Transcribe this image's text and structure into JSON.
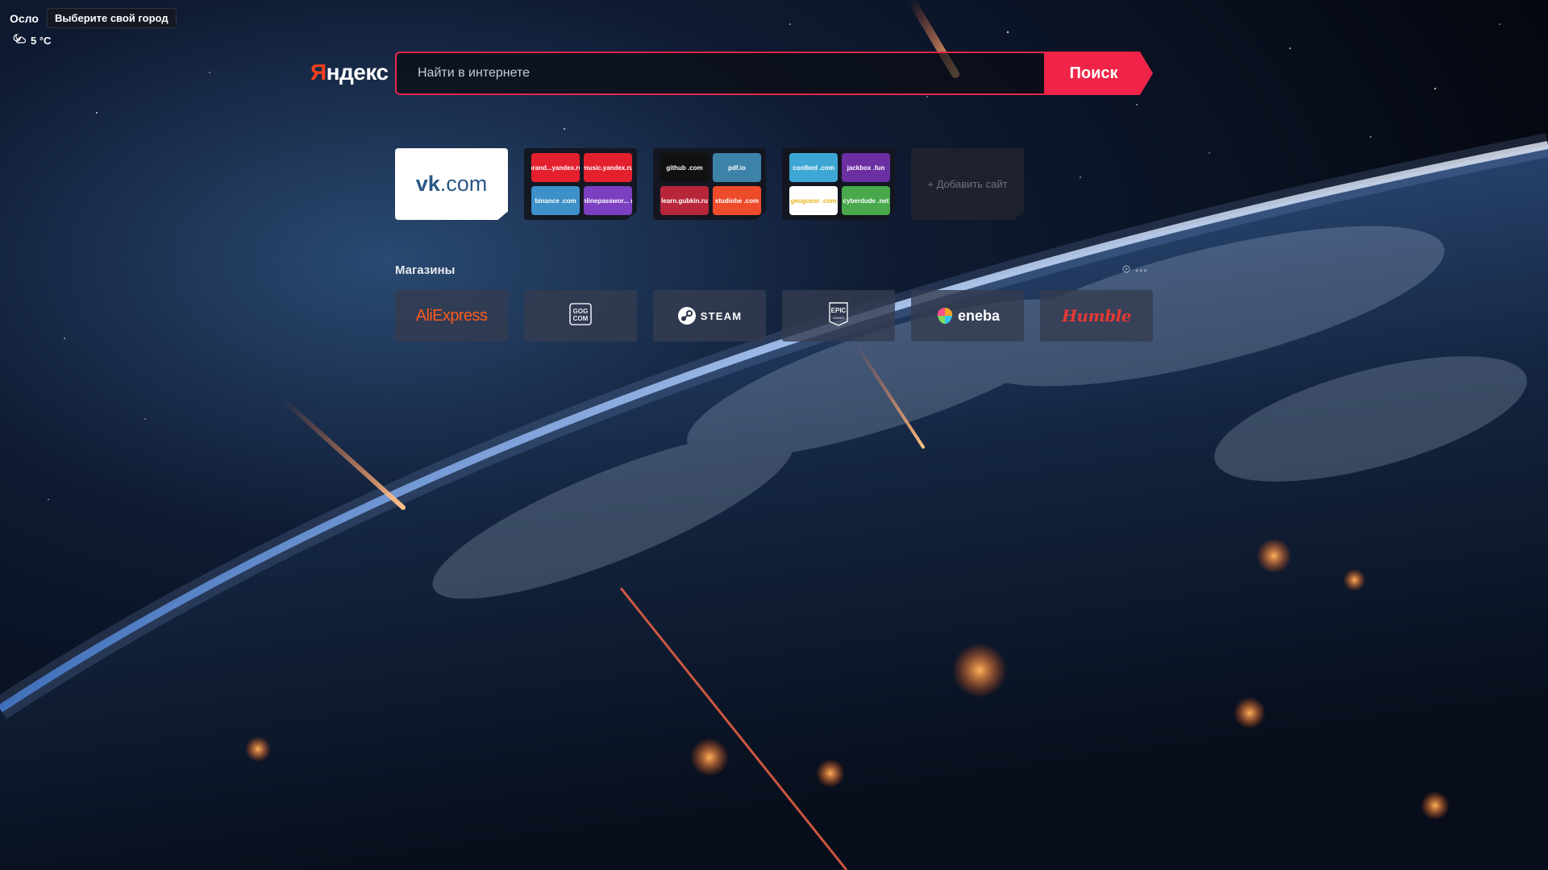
{
  "weather": {
    "city": "Осло",
    "city_tooltip": "Выберите свой город",
    "temperature": "5 °C",
    "icon": "cloud-moon-icon"
  },
  "header": {
    "logo_text": "Яндекс",
    "search_placeholder": "Найти в интернете",
    "search_button_label": "Поиск"
  },
  "tiles": {
    "vk": {
      "label_bold": "vk",
      "label_rest": ".com"
    },
    "groups": [
      {
        "items": [
          {
            "label": "brand...yandex.ru",
            "color": "#e4202f"
          },
          {
            "label": "music.yandex.ru",
            "color": "#e4202f"
          },
          {
            "label": "binance .com",
            "color": "#3d90c8"
          },
          {
            "label": "onlinepasswor... ru",
            "color": "#7b3fc1"
          }
        ]
      },
      {
        "items": [
          {
            "label": "github .com",
            "color": "#111111"
          },
          {
            "label": "pdf.io",
            "color": "#3d82a8"
          },
          {
            "label": "learn.gubkin.ru",
            "color": "#b8263a"
          },
          {
            "label": "studiobe .com",
            "color": "#ee4b2b"
          }
        ]
      },
      {
        "items": [
          {
            "label": "coolbed .com",
            "color": "#3ea6d4"
          },
          {
            "label": "jackbox .fun",
            "color": "#6b2fa2"
          },
          {
            "label": "geoguesr .com",
            "color": "#ffffff",
            "text_color": "#e8b317"
          },
          {
            "label": "cyberdude .net",
            "color": "#48a84b"
          }
        ]
      }
    ],
    "add_site_label": "+ Добавить сайт"
  },
  "shops": {
    "title": "Магазины",
    "items": [
      {
        "name": "AliExpress",
        "label": "AliExpress",
        "color": "#ff5a1f"
      },
      {
        "name": "GOG",
        "label_top": "GOG",
        "label_bottom": "COM"
      },
      {
        "name": "Steam",
        "label": "STEAM"
      },
      {
        "name": "Epic Games",
        "label_top": "EPIC",
        "label_bottom": "GAMES"
      },
      {
        "name": "eneba",
        "label": "eneba"
      },
      {
        "name": "Humble",
        "label": "Humble",
        "color": "#e53935"
      }
    ]
  }
}
